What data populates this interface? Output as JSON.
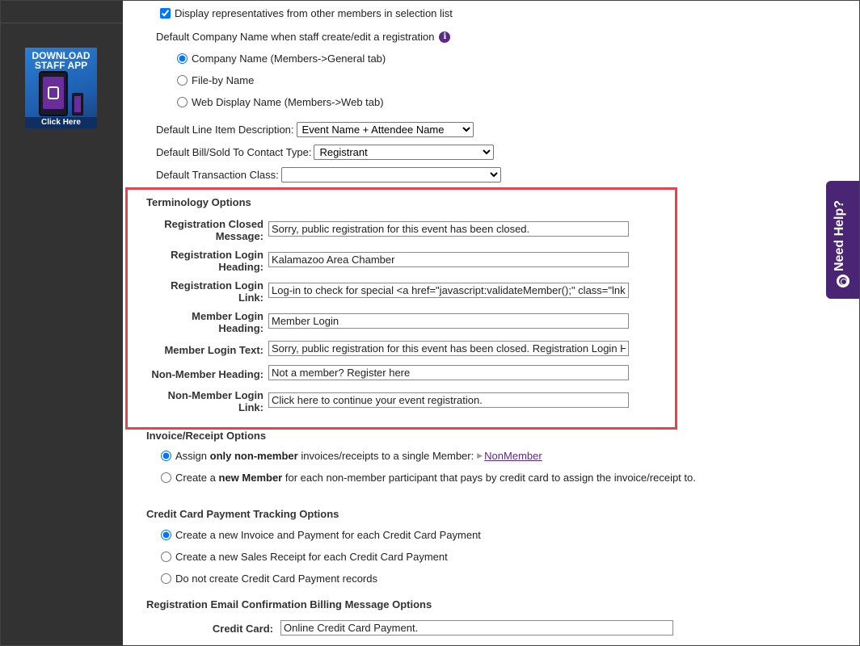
{
  "sidebar": {
    "top_text": "...",
    "banner": {
      "title": "DOWNLOAD STAFF APP",
      "cta": "Click Here"
    }
  },
  "general": {
    "display_reps_label": "Display representatives from other members in selection list",
    "display_reps_checked": true,
    "default_company_label": "Default Company Name when staff create/edit a registration",
    "company_options": [
      "Company Name (Members->General tab)",
      "File-by Name",
      "Web Display Name (Members->Web tab)"
    ],
    "company_selected_index": 0,
    "line_item_label": "Default Line Item Description:",
    "line_item_value": "Event Name + Attendee Name",
    "bill_sold_label": "Default Bill/Sold To Contact Type:",
    "bill_sold_value": "Registrant",
    "transaction_class_label": "Default Transaction Class:",
    "transaction_class_value": ""
  },
  "terminology": {
    "title": "Terminology Options",
    "fields": [
      {
        "label1": "Registration Closed",
        "label2": "Message:",
        "value": "Sorry, public registration for this event has been closed."
      },
      {
        "label1": "Registration Login",
        "label2": "Heading:",
        "value": "Kalamazoo Area Chamber"
      },
      {
        "label1": "Registration Login",
        "label2": "Link:",
        "value": "Log-in to check for special <a href=\"javascript:validateMember();\" class=\"lnkM"
      },
      {
        "label1": "Member Login",
        "label2": "Heading:",
        "value": "Member Login"
      },
      {
        "label1": "Member Login Text:",
        "label2": "",
        "value": "Sorry, public registration for this event has been closed. Registration Login H"
      },
      {
        "label1": "Non-Member Heading:",
        "label2": "",
        "value": "Not a member? Register here"
      },
      {
        "label1": "Non-Member Login",
        "label2": "Link:",
        "value": "Click here to continue your event registration."
      }
    ]
  },
  "invoice": {
    "title": "Invoice/Receipt Options",
    "opt1_pre": "Assign ",
    "opt1_bold1": "only non-member",
    "opt1_mid": " invoices/receipts to a single Member:",
    "opt1_link": "NonMember",
    "opt2_pre": "Create a ",
    "opt2_bold": "new Member",
    "opt2_post": " for each non-member participant that pays by credit card to assign the invoice/receipt to.",
    "selected_index": 0
  },
  "credit_card": {
    "title": "Credit Card Payment Tracking Options",
    "options": [
      "Create a new Invoice and Payment for each Credit Card Payment",
      "Create a new Sales Receipt for each Credit Card Payment",
      "Do not create Credit Card Payment records"
    ],
    "selected_index": 0
  },
  "email_billing": {
    "title": "Registration Email Confirmation Billing Message Options",
    "credit_card_label": "Credit Card:",
    "credit_card_value": "Online Credit Card Payment."
  },
  "help_tab": {
    "label": "Need Help?"
  }
}
